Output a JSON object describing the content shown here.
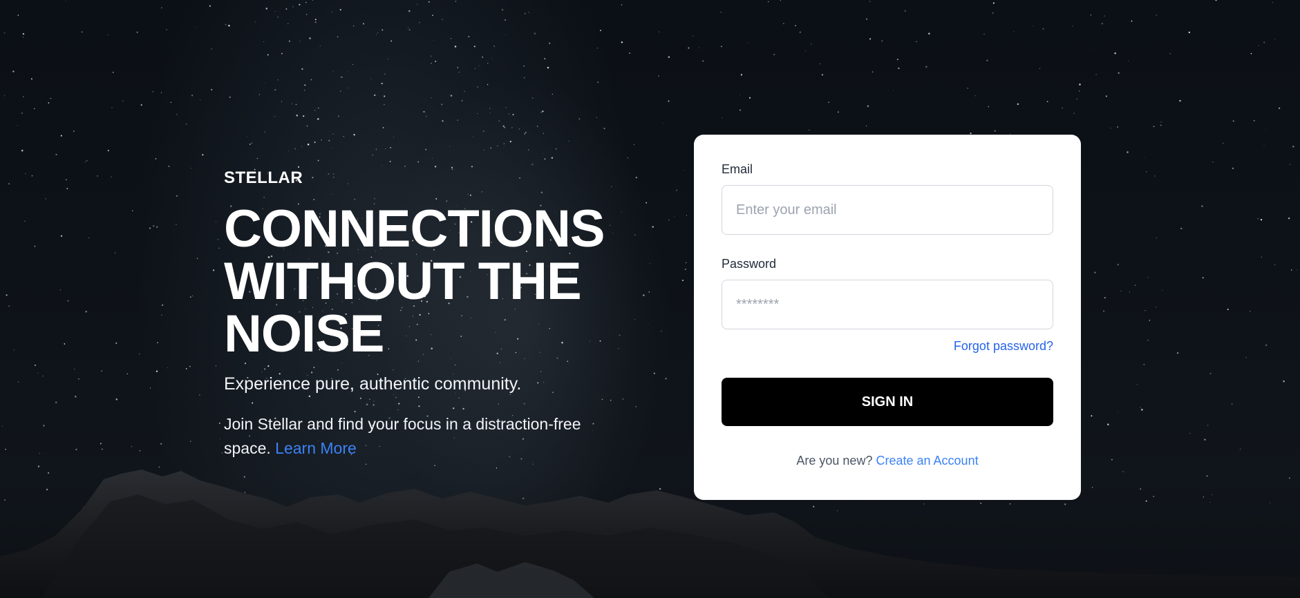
{
  "hero": {
    "brand": "STELLAR",
    "headline": "CONNECTIONS\nWITHOUT THE\nNOISE",
    "subtitle": "Experience pure, authentic community.",
    "description": "Join Stellar and find your focus in a distraction-free space.",
    "learn_more": "Learn More"
  },
  "login": {
    "email_label": "Email",
    "email_placeholder": "Enter your email",
    "email_value": "",
    "password_label": "Password",
    "password_placeholder": "********",
    "password_value": "",
    "forgot_password": "Forgot password?",
    "sign_in": "SIGN IN",
    "new_prompt": "Are you new?",
    "create_account": "Create an Account"
  },
  "colors": {
    "accent_link": "#3b82f6",
    "forgot_link": "#2563eb",
    "button_bg": "#000000",
    "card_bg": "#ffffff",
    "background": "#0d1218"
  }
}
